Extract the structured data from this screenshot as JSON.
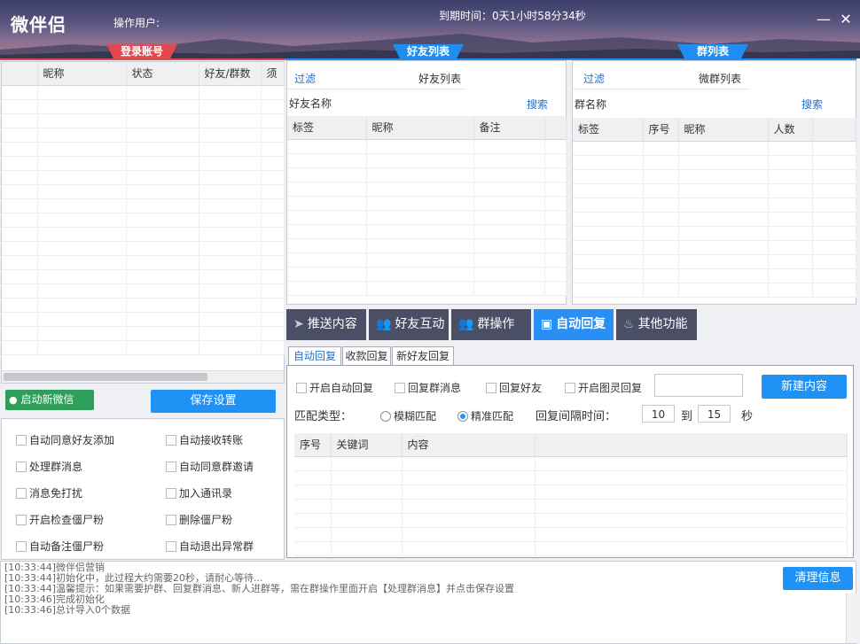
{
  "window": {
    "title": "微伴侣",
    "operator_label": "操作用户:",
    "expire_label": "到期时间：0天1小时58分34秒",
    "minimize": "—",
    "close": "✕"
  },
  "sections": {
    "login_accounts": "登录账号",
    "friends_list": "好友列表",
    "groups_list": "群列表"
  },
  "accounts_table": {
    "columns": [
      "",
      "昵称",
      "状态",
      "好友/群数",
      "须"
    ]
  },
  "friends": {
    "filter_tab": "过滤",
    "list_tab": "好友列表",
    "search_label": "好友名称",
    "search_button": "搜索",
    "columns": [
      "标签",
      "昵称",
      "备注"
    ]
  },
  "groups": {
    "filter_tab": "过滤",
    "list_tab": "微群列表",
    "search_label": "群名称",
    "search_button": "搜索",
    "columns": [
      "标签",
      "序号",
      "昵称",
      "人数"
    ]
  },
  "left_buttons": {
    "start_wechat": "启动新微信",
    "save_settings": "保存设置"
  },
  "options": [
    "自动同意好友添加",
    "自动接收转账",
    "处理群消息",
    "自动同意群邀请",
    "消息免打扰",
    "加入通讯录",
    "开启检查僵尸粉",
    "删除僵尸粉",
    "自动备注僵尸粉",
    "自动退出异常群"
  ],
  "function_tabs": [
    {
      "label": "推送内容",
      "icon": "paper-plane"
    },
    {
      "label": "好友互动",
      "icon": "users"
    },
    {
      "label": "群操作",
      "icon": "group"
    },
    {
      "label": "自动回复",
      "icon": "robot"
    },
    {
      "label": "其他功能",
      "icon": "fire"
    }
  ],
  "active_function_tab": "自动回复",
  "reply": {
    "subtabs": [
      "自动回复",
      "收款回复",
      "新好友回复"
    ],
    "active_subtab": "自动回复",
    "checks": [
      "开启自动回复",
      "回复群消息",
      "回复好友",
      "开启图灵回复"
    ],
    "new_content_button": "新建内容",
    "match_type_label": "匹配类型：",
    "match_fuzzy": "模糊匹配",
    "match_exact": "精准匹配",
    "selected_match": "精准匹配",
    "interval_label": "回复间隔时间：",
    "interval_from": "10",
    "interval_to_label": "到",
    "interval_to": "15",
    "interval_unit": "秒",
    "columns": [
      "序号",
      "关键词",
      "内容"
    ]
  },
  "log": {
    "clear_button": "清理信息",
    "lines": [
      "[10:33:44]微伴侣营销",
      "[10:33:44]初始化中，此过程大约需要20秒，请耐心等待...",
      "[10:33:44]温馨提示：如果需要护群、回复群消息、新人进群等，需在群操作里面开启【处理群消息】并点击保存设置",
      "[10:33:46]完成初始化",
      "[10:33:46]总计导入0个数据"
    ]
  },
  "colors": {
    "accent_blue": "#2192f5",
    "accent_red": "#e04a4f",
    "tab_dark": "#4a4f66",
    "green": "#2e9e5a"
  }
}
